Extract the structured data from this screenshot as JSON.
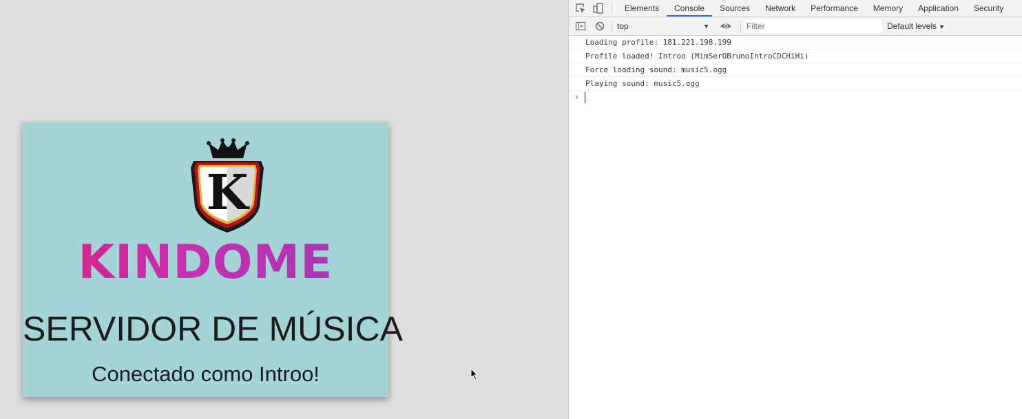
{
  "page": {
    "brand": "KINDOME",
    "logo_letter": "K",
    "headline": "SERVIDOR DE MÚSICA",
    "status": "Conectado como Introo!"
  },
  "devtools": {
    "tabs": [
      {
        "label": "Elements",
        "active": false
      },
      {
        "label": "Console",
        "active": true
      },
      {
        "label": "Sources",
        "active": false
      },
      {
        "label": "Network",
        "active": false
      },
      {
        "label": "Performance",
        "active": false
      },
      {
        "label": "Memory",
        "active": false
      },
      {
        "label": "Application",
        "active": false
      },
      {
        "label": "Security",
        "active": false
      }
    ],
    "toolbar": {
      "context": "top",
      "filter_placeholder": "Filter",
      "levels": "Default levels"
    },
    "console_lines": [
      "Loading profile: 181.221.198.199",
      "Profile loaded! Introo (MimSerOBrunoIntroCDCHiHi)",
      "Force loading sound: music5.ogg",
      "Playing sound: music5.ogg"
    ],
    "prompt_value": ""
  },
  "colors": {
    "card_bg": "#a4d4d6",
    "brand_gradient_start": "#d8237e",
    "brand_gradient_end": "#a13ab4",
    "active_tab_underline": "#1a73e8"
  },
  "icons": [
    "inspect-element-icon",
    "device-toolbar-icon",
    "sidebar-toggle-icon",
    "clear-console-icon",
    "eye-icon",
    "chevron-prompt-icon",
    "mouse-cursor-icon"
  ]
}
